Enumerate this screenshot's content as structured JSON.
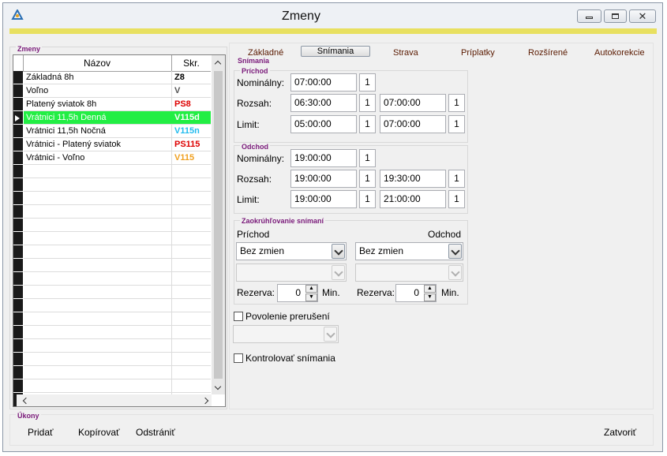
{
  "window": {
    "title": "Zmeny"
  },
  "left": {
    "group_title": "Zmeny",
    "columns": {
      "name": "Názov",
      "code": "Skr."
    },
    "rows": [
      {
        "name": "Základná 8h",
        "code": "Z8",
        "code_color": "#000000"
      },
      {
        "name": "Voľno",
        "code": "V",
        "code_color": "#555555"
      },
      {
        "name": "Platený sviatok 8h",
        "code": "PS8",
        "code_color": "#dd0000"
      },
      {
        "name": "Vrátnici 11,5h Denná",
        "code": "V115d",
        "code_color": "#ffffff",
        "selected": true
      },
      {
        "name": "Vrátnici 11,5h Nočná",
        "code": "V115n",
        "code_color": "#22bbee"
      },
      {
        "name": "Vrátnici - Platený sviatok",
        "code": "PS115",
        "code_color": "#dd0000"
      },
      {
        "name": "Vrátnici - Voľno",
        "code": "V115",
        "code_color": "#f0a020"
      }
    ],
    "selected_color": "#22ee44"
  },
  "tabs": [
    {
      "label": "Základné"
    },
    {
      "label": "Snímania",
      "active": true
    },
    {
      "label": "Strava"
    },
    {
      "label": "Príplatky"
    },
    {
      "label": "Rozšírené"
    },
    {
      "label": "Autokorekcie"
    }
  ],
  "snimania": {
    "group_title": "Snímania",
    "prichod": {
      "title": "Príchod",
      "nominalny": {
        "label": "Nominálny:",
        "time": "07:00:00",
        "day": "1"
      },
      "rozsah": {
        "label": "Rozsah:",
        "from": "06:30:00",
        "from_day": "1",
        "to": "07:00:00",
        "to_day": "1"
      },
      "limit": {
        "label": "Limit:",
        "from": "05:00:00",
        "from_day": "1",
        "to": "07:00:00",
        "to_day": "1"
      }
    },
    "odchod": {
      "title": "Odchod",
      "nominalny": {
        "label": "Nominálny:",
        "time": "19:00:00",
        "day": "1"
      },
      "rozsah": {
        "label": "Rozsah:",
        "from": "19:00:00",
        "from_day": "1",
        "to": "19:30:00",
        "to_day": "1"
      },
      "limit": {
        "label": "Limit:",
        "from": "19:00:00",
        "from_day": "1",
        "to": "21:00:00",
        "to_day": "1"
      }
    },
    "zaokruhlovanie": {
      "title": "Zaokrúhľovanie snímaní",
      "prichod_label": "Príchod",
      "odchod_label": "Odchod",
      "prichod_value": "Bez zmien",
      "odchod_value": "Bez zmien",
      "rezerva_label": "Rezerva:",
      "prichod_rezerva": "0",
      "odchod_rezerva": "0",
      "unit": "Min."
    },
    "povolenie": {
      "label": "Povolenie prerušení",
      "checked": false
    },
    "kontrolovat": {
      "label": "Kontrolovať snímania",
      "checked": false
    }
  },
  "bottom": {
    "group_title": "Úkony",
    "add": "Pridať",
    "copy": "Kopírovať",
    "remove": "Odstrániť",
    "close": "Zatvoriť"
  }
}
